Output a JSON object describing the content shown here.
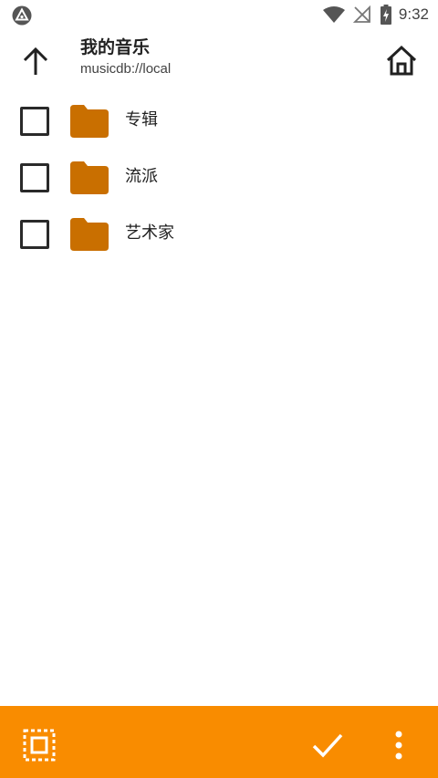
{
  "status_bar": {
    "left_icon": "notification-app-icon",
    "wifi_icon": "wifi-icon",
    "signal_icon": "no-signal-icon",
    "battery_icon": "battery-charging-icon",
    "time": "9:32"
  },
  "toolbar": {
    "back_icon": "arrow-up-icon",
    "title": "我的音乐",
    "subtitle": "musicdb://local",
    "home_icon": "home-icon"
  },
  "list": {
    "items": [
      {
        "label": "专辑",
        "icon": "folder-icon",
        "checked": false
      },
      {
        "label": "流派",
        "icon": "folder-icon",
        "checked": false
      },
      {
        "label": "艺术家",
        "icon": "folder-icon",
        "checked": false
      }
    ]
  },
  "bottom_bar": {
    "select_icon": "select-all-icon",
    "confirm_icon": "check-icon",
    "more_icon": "more-vert-icon"
  },
  "colors": {
    "accent": "#f98c00",
    "folder": "#c96f00",
    "text": "#212121"
  }
}
